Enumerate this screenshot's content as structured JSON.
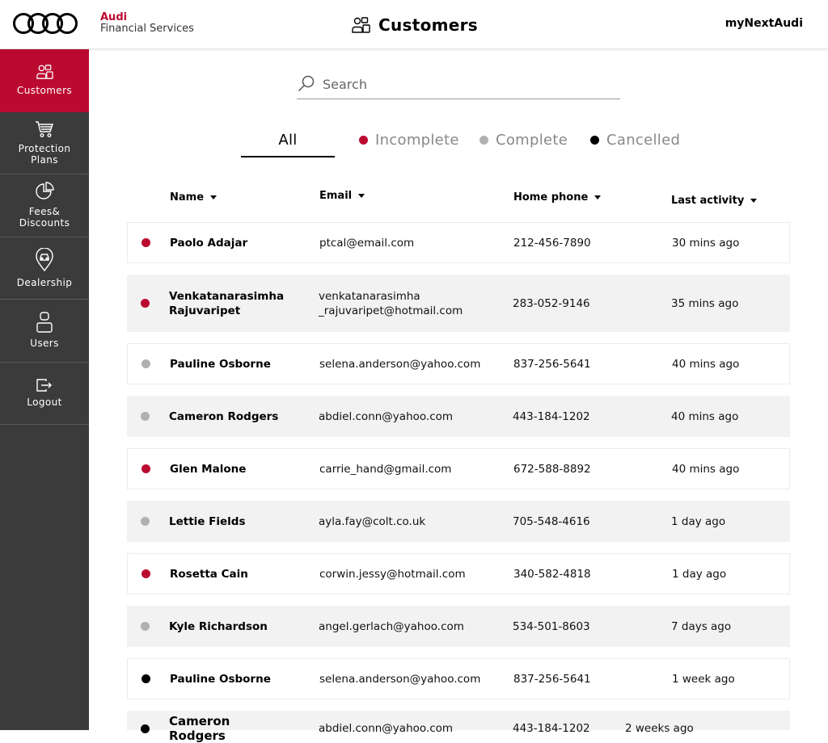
{
  "header": {
    "brand_line1": "Audi",
    "brand_line2": "Financial Services",
    "title": "Customers",
    "right_link": "myNextAudi"
  },
  "sidebar": {
    "items": [
      {
        "label": "Customers",
        "icon": "customers-icon",
        "active": true
      },
      {
        "label": "Protection Plans",
        "icon": "cart-icon",
        "active": false
      },
      {
        "label": "Fees& Discounts",
        "icon": "pie-chart-icon",
        "active": false
      },
      {
        "label": "Dealership",
        "icon": "location-pin-icon",
        "active": false
      },
      {
        "label": "Users",
        "icon": "user-icon",
        "active": false
      },
      {
        "label": "Logout",
        "icon": "logout-icon",
        "active": false
      }
    ]
  },
  "search": {
    "placeholder": "Search"
  },
  "tabs": [
    {
      "label": "All",
      "selected": true,
      "dot_color": ""
    },
    {
      "label": "Incomplete",
      "selected": false,
      "dot_color": "#bb0a30"
    },
    {
      "label": "Complete",
      "selected": false,
      "dot_color": "#b0b0b0"
    },
    {
      "label": "Cancelled",
      "selected": false,
      "dot_color": "#000000"
    }
  ],
  "table": {
    "columns": [
      "Name",
      "Email",
      "Home phone",
      "Last activity"
    ],
    "rows": [
      {
        "status": "incomplete",
        "name": "Paolo Adajar",
        "email": "ptcal@email.com",
        "phone": "212-456-7890",
        "activity": "30 mins ago"
      },
      {
        "status": "incomplete",
        "name": "Venkatanarasimha Rajuvaripet",
        "email": "venkatanarasimha _rajuvaripet@hotmail.com",
        "phone": "283-052-9146",
        "activity": "35 mins ago"
      },
      {
        "status": "complete",
        "name": "Pauline Osborne",
        "email": "selena.anderson@yahoo.com",
        "phone": "837-256-5641",
        "activity": "40 mins ago"
      },
      {
        "status": "complete",
        "name": "Cameron Rodgers",
        "email": "abdiel.conn@yahoo.com",
        "phone": "443-184-1202",
        "activity": "40 mins ago"
      },
      {
        "status": "incomplete",
        "name": "Glen Malone",
        "email": "carrie_hand@gmail.com",
        "phone": "672-588-8892",
        "activity": "40 mins ago"
      },
      {
        "status": "complete",
        "name": "Lettie Fields",
        "email": "ayla.fay@colt.co.uk",
        "phone": "705-548-4616",
        "activity": "1 day ago"
      },
      {
        "status": "incomplete",
        "name": "Rosetta Cain",
        "email": "corwin.jessy@hotmail.com",
        "phone": "340-582-4818",
        "activity": "1 day ago"
      },
      {
        "status": "complete",
        "name": "Kyle Richardson",
        "email": "angel.gerlach@yahoo.com",
        "phone": "534-501-8603",
        "activity": "7 days ago"
      },
      {
        "status": "cancelled",
        "name": "Pauline Osborne",
        "email": "selena.anderson@yahoo.com",
        "phone": "837-256-5641",
        "activity": "1 week ago"
      },
      {
        "status": "cancelled",
        "name": "Cameron Rodgers",
        "email": "abdiel.conn@yahoo.com",
        "phone": "443-184-1202",
        "activity": "2 weeks ago"
      }
    ]
  },
  "colors": {
    "accent": "#bb0a30",
    "sidebar_bg": "#3b3b3b",
    "incomplete": "#bb0a30",
    "complete": "#b0b0b0",
    "cancelled": "#000000"
  }
}
